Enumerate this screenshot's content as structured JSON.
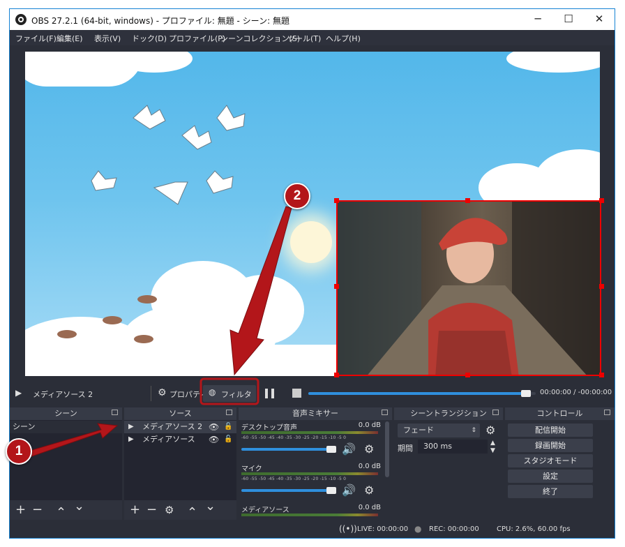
{
  "window": {
    "title": "OBS 27.2.1 (64-bit, windows) - プロファイル: 無題 - シーン: 無題",
    "minimize": "─",
    "maximize": "☐",
    "close": "✕"
  },
  "menu": [
    "ファイル(F)",
    "編集(E)",
    "表示(V)",
    "ドック(D)",
    "プロファイル(P)",
    "シーンコレクション(S)",
    "ツール(T)",
    "ヘルプ(H)"
  ],
  "control_bar": {
    "play_icon": "▶",
    "source_name": "メディアソース 2",
    "properties_label": "プロパティ",
    "filter_label": "フィルタ",
    "time": "00:00:00 / -00:00:00",
    "progress": 0.98
  },
  "docks": {
    "scenes": {
      "title": "シーン",
      "items": [
        "シーン"
      ]
    },
    "sources": {
      "title": "ソース",
      "items": [
        "メディアソース 2",
        "メディアソース"
      ]
    },
    "mixer": {
      "title": "音声ミキサー",
      "ticks": "-60 -55 -50 -45 -40 -35 -30 -25 -20 -15 -10  -5  0",
      "channels": [
        {
          "name": "デスクトップ音声",
          "db": "0.0 dB"
        },
        {
          "name": "マイク",
          "db": "0.0 dB"
        },
        {
          "name": "メディアソース",
          "db": "0.0 dB"
        }
      ]
    },
    "transitions": {
      "title": "シーントランジション",
      "type": "フェード",
      "duration_label": "期間",
      "duration_value": "300 ms"
    },
    "controls": {
      "title": "コントロール",
      "buttons": [
        "配信開始",
        "録画開始",
        "スタジオモード",
        "設定",
        "終了"
      ]
    }
  },
  "toolbar_icons": {
    "add": "+",
    "remove": "−",
    "up": "⌃",
    "down": "⌄",
    "gear": "⚙"
  },
  "status": {
    "live": "LIVE: 00:00:00",
    "rec": "REC: 00:00:00",
    "cpu": "CPU: 2.6%, 60.00 fps"
  },
  "annotations": {
    "badge1": "1",
    "badge2": "2"
  },
  "colors": {
    "accent": "#2f8fdd",
    "annotation": "#b3161a",
    "selection": "#e00000"
  }
}
